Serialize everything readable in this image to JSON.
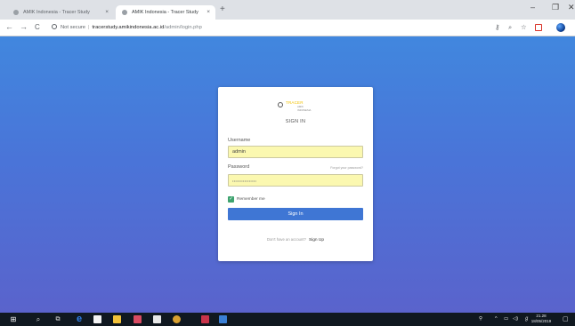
{
  "browser": {
    "tabs": [
      {
        "title": "AMIK Indonesia - Tracer Study",
        "close": "×"
      },
      {
        "title": "AMIK Indonesia - Tracer Study",
        "close": "×"
      }
    ],
    "new_tab": "+",
    "window_controls": {
      "minimize": "–",
      "restore": "❐",
      "close": "✕"
    },
    "nav": {
      "back": "←",
      "forward": "→",
      "reload": "C"
    },
    "address": {
      "security_label": "Not secure",
      "host": "tracerstudy.amikindonesia.ac.id",
      "path": "/admin/login.php"
    },
    "toolbar_icons": [
      "key-icon",
      "zoom-icon",
      "star-icon",
      "extension-icon",
      "profile-icon"
    ]
  },
  "login": {
    "logo_text": "TRACER",
    "logo_sub": "AMIK INDONESIA",
    "title": "SIGN IN",
    "username_label": "Username",
    "username_value": "admin",
    "password_label": "Password",
    "forgot_label": "Forgot your password?",
    "password_value": "••••••••••••••••",
    "remember_label": "Remember me",
    "remember_checked": true,
    "signin_button": "Sign In",
    "signup_prompt": "Don't have an account?",
    "signup_link": "Sign Up"
  },
  "taskbar": {
    "apps": [
      "windows-icon",
      "search-icon",
      "task-view-icon",
      "edge-icon",
      "store-icon",
      "file-explorer-icon",
      "media-icon",
      "mail-icon",
      "chrome-icon",
      "app-icon",
      "app-icon"
    ],
    "tray_icons": [
      "people-icon",
      "chevron-up-icon",
      "battery-icon",
      "volume-icon",
      "language-icon"
    ],
    "time": "21.28",
    "date": "18/05/2019",
    "notification_icon": "notification-icon"
  },
  "colors": {
    "accent": "#3f76d4",
    "autofill": "#fbf8b0",
    "checkbox": "#3ea36f",
    "page_top": "#4187de",
    "page_bottom": "#5a63cc"
  }
}
